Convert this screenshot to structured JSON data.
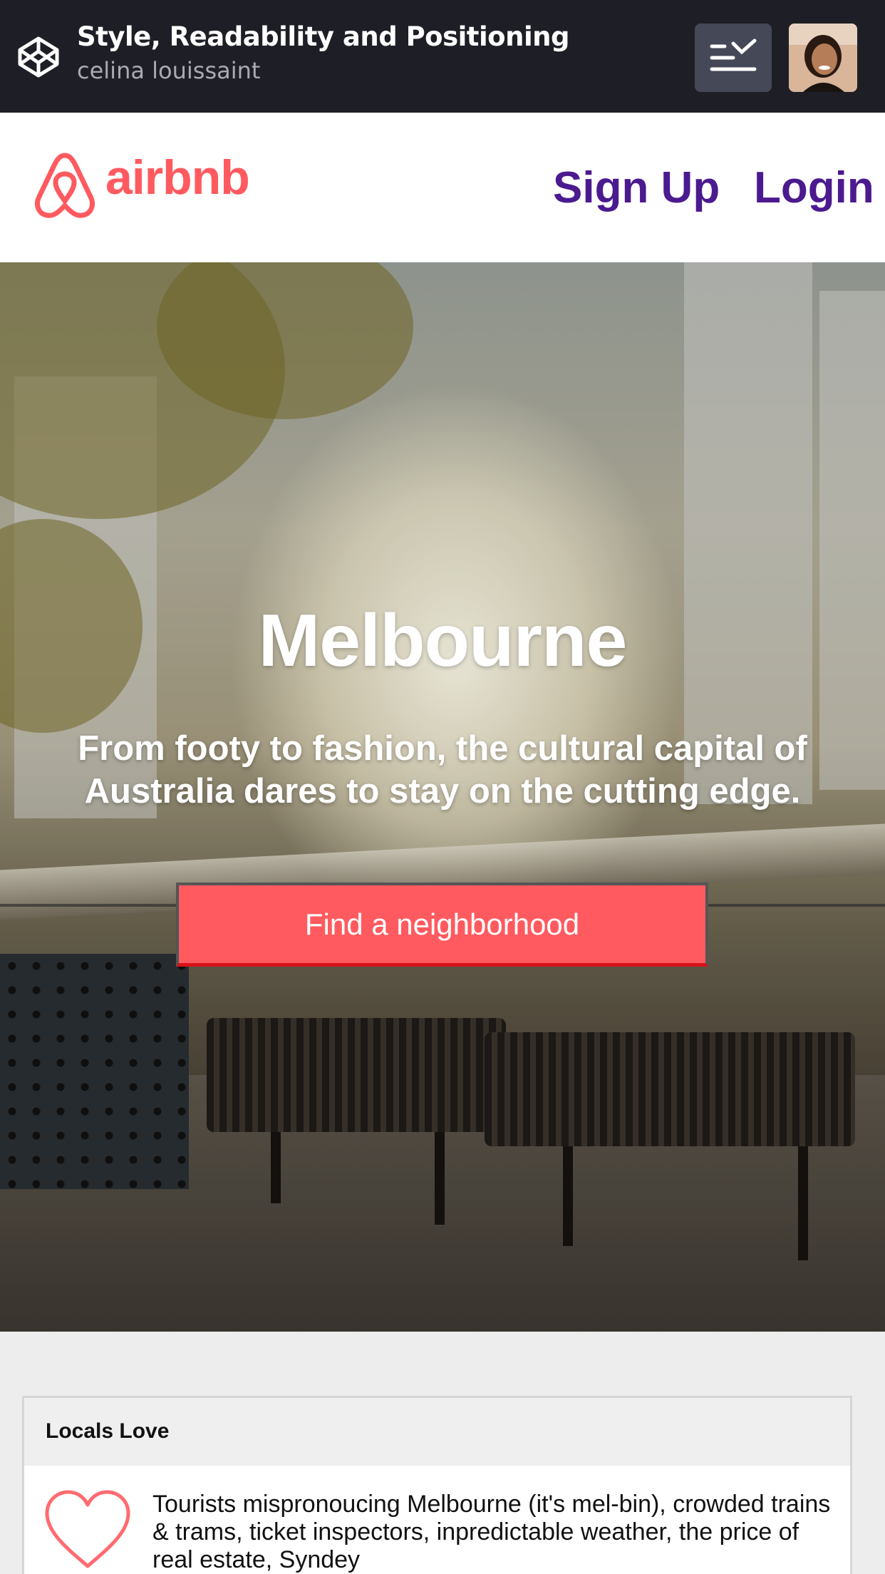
{
  "codepen": {
    "title": "Style, Readability and Positioning",
    "author": "celina louissaint",
    "logo_icon": "codepen-cube-icon",
    "menu_icon": "list-check-icon"
  },
  "site_header": {
    "brand": "airbnb",
    "brand_color": "#ff5a5f",
    "nav": {
      "signup": "Sign Up",
      "login": "Login"
    },
    "nav_color": "#4b1a8f"
  },
  "hero": {
    "title": "Melbourne",
    "subtitle": "From footy to fashion, the cultural capital of Australia dares to stay on the cutting edge.",
    "cta_label": "Find a neighborhood",
    "cta_color": "#ff5a5f"
  },
  "locals_card": {
    "heading": "Locals Love",
    "icon": "heart-outline-icon",
    "text": "Tourists mispronoucing Melbourne (it's mel-bin), crowded trains & trams, ticket inspectors, inpredictable weather, the price of real estate, Syndey"
  }
}
